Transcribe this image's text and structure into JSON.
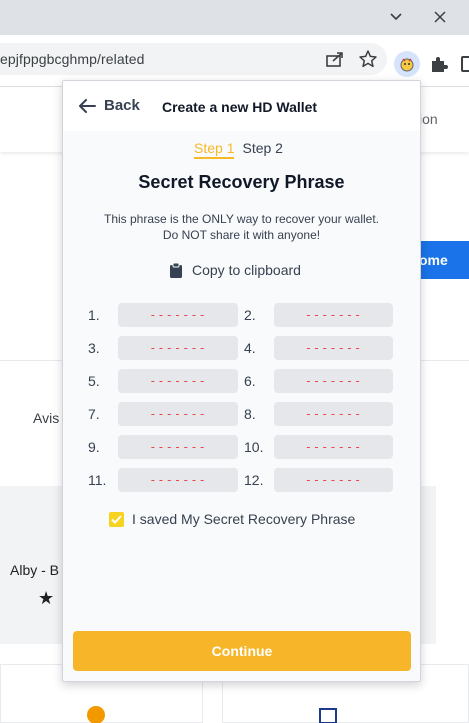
{
  "browser": {
    "url_fragment": "epjfppgbcghmp/related",
    "icons": [
      "chevron-down-icon",
      "close-icon",
      "share-icon",
      "star-icon",
      "alby-extension-icon",
      "puzzle-icon",
      "side-panel-icon"
    ]
  },
  "background_page": {
    "header_partial": "ion",
    "button_partial": "ome",
    "text_avis": "Avis",
    "card_title_partial": "Alby - B",
    "accent_color": "#1a73e8"
  },
  "popup": {
    "back_label": "Back",
    "title": "Create a new HD Wallet",
    "step_1": "Step 1",
    "step_2": "Step 2",
    "phrase_title": "Secret Recovery Phrase",
    "warning_line_1": "This phrase is the ONLY way to recover your wallet.",
    "warning_line_2": "Do NOT share it with anyone!",
    "copy_label": "Copy to clipboard",
    "words": [
      {
        "num": "1.",
        "word": "-------"
      },
      {
        "num": "2.",
        "word": "-------"
      },
      {
        "num": "3.",
        "word": "-------"
      },
      {
        "num": "4.",
        "word": "-------"
      },
      {
        "num": "5.",
        "word": "-------"
      },
      {
        "num": "6.",
        "word": "-------"
      },
      {
        "num": "7.",
        "word": "-------"
      },
      {
        "num": "8.",
        "word": "-------"
      },
      {
        "num": "9.",
        "word": "-------"
      },
      {
        "num": "10.",
        "word": "-------"
      },
      {
        "num": "11.",
        "word": "-------"
      },
      {
        "num": "12.",
        "word": "-------"
      }
    ],
    "checkbox_label": "I saved My Secret Recovery Phrase",
    "checkbox_checked": true,
    "continue_label": "Continue",
    "accent_color": "#f7b62a"
  }
}
